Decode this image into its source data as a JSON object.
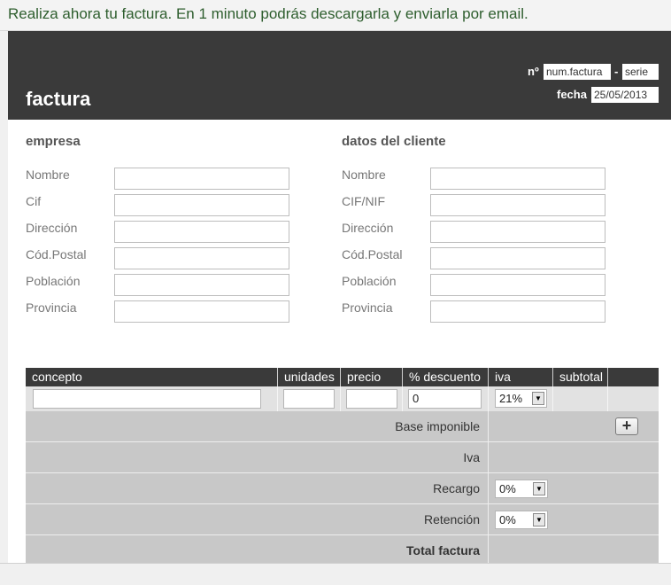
{
  "banner": {
    "text": "Realiza ahora tu factura. En 1 minuto podrás descargarla y enviarla por email."
  },
  "header": {
    "title": "factura",
    "num_label": "nº",
    "num_value": "num.factura",
    "separator": "-",
    "serie_value": "serie",
    "fecha_label": "fecha",
    "fecha_value": "25/05/2013"
  },
  "empresa": {
    "title": "empresa",
    "fields": [
      "Nombre",
      "Cif",
      "Dirección",
      "Cód.Postal",
      "Población",
      "Provincia"
    ]
  },
  "cliente": {
    "title": "datos del cliente",
    "fields": [
      "Nombre",
      "CIF/NIF",
      "Dirección",
      "Cód.Postal",
      "Población",
      "Provincia"
    ]
  },
  "table": {
    "columns": [
      "concepto",
      "unidades",
      "precio",
      "% descuento",
      "iva",
      "subtotal"
    ],
    "item": {
      "descuento": "0",
      "iva": "21%"
    }
  },
  "totals": {
    "base_label": "Base imponible",
    "iva_label": "Iva",
    "recargo_label": "Recargo",
    "recargo_value": "0%",
    "retencion_label": "Retención",
    "retencion_value": "0%",
    "total_label": "Total factura",
    "add_button": "+"
  },
  "icons": {
    "select_arrow": "dropdown-arrow-icon",
    "add": "plus-icon"
  }
}
